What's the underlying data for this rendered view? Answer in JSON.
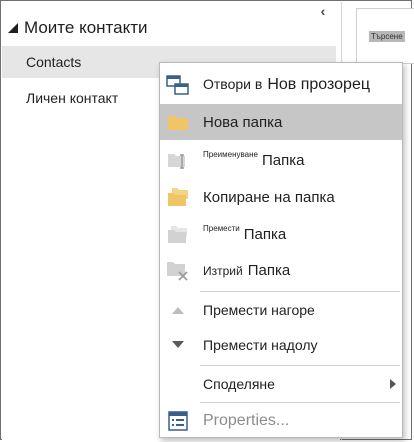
{
  "folder_pane": {
    "group_header": "Моите контакти",
    "items": [
      {
        "label": "Contacts",
        "selected": true
      },
      {
        "label": "Личен контакт",
        "selected": false
      }
    ]
  },
  "reading_pane": {
    "search_label": "Търсене"
  },
  "context_menu": {
    "open_new_window": {
      "prefix": "Отвори в",
      "emphasis": "Нов прозорец"
    },
    "new_folder": "Нова папка",
    "rename_folder": {
      "small": "Преименуване",
      "main": "Папка"
    },
    "copy_folder": "Копиране на папка",
    "move_folder": {
      "small": "Премести",
      "main": "Папка"
    },
    "delete_folder": {
      "small": "Изтрий",
      "main": "Папка"
    },
    "move_up": "Премести нагоре",
    "move_down": "Премести надолу",
    "share": "Споделяне",
    "properties": "Properties..."
  },
  "colors": {
    "folder_yellow": "#f0c567",
    "hover_bg": "#c6c6c6",
    "selected_bg": "#e6e6e6",
    "disabled_text": "#8c8c8c"
  }
}
